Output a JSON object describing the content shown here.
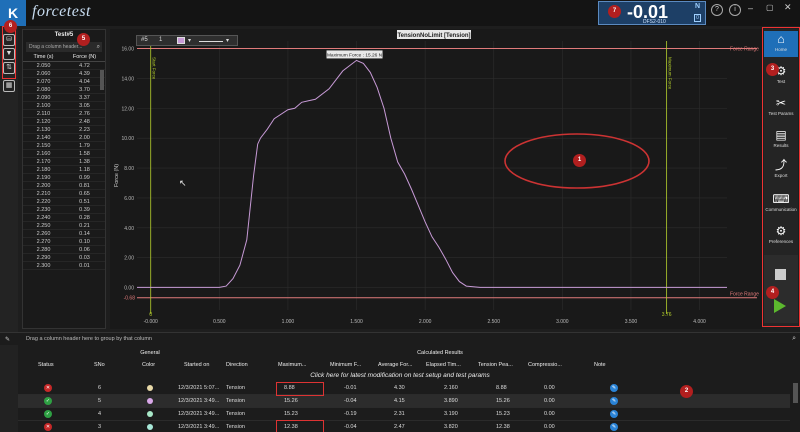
{
  "app": {
    "logo_text": "forcetest",
    "logo_glyph": "K"
  },
  "readout": {
    "value": "-0.01",
    "unit": "N",
    "device": "DFS2-010",
    "mode": "0"
  },
  "left_toolbar": {
    "icons": [
      "database-icon",
      "filter-icon",
      "sort-icon",
      "table-icon"
    ]
  },
  "data_panel": {
    "title": "Test#5",
    "search_placeholder": "Drag a column header...",
    "columns": [
      "Time (s)",
      "Force (N)"
    ],
    "rows": [
      [
        "2.050",
        "4.72"
      ],
      [
        "2.060",
        "4.39"
      ],
      [
        "2.070",
        "4.04"
      ],
      [
        "2.080",
        "3.70"
      ],
      [
        "2.090",
        "3.37"
      ],
      [
        "2.100",
        "3.05"
      ],
      [
        "2.110",
        "2.76"
      ],
      [
        "2.120",
        "2.48"
      ],
      [
        "2.130",
        "2.23"
      ],
      [
        "2.140",
        "2.00"
      ],
      [
        "2.150",
        "1.79"
      ],
      [
        "2.160",
        "1.58"
      ],
      [
        "2.170",
        "1.38"
      ],
      [
        "2.180",
        "1.18"
      ],
      [
        "2.190",
        "0.99"
      ],
      [
        "2.200",
        "0.81"
      ],
      [
        "2.210",
        "0.65"
      ],
      [
        "2.220",
        "0.51"
      ],
      [
        "2.230",
        "0.39"
      ],
      [
        "2.240",
        "0.28"
      ],
      [
        "2.250",
        "0.21"
      ],
      [
        "2.260",
        "0.14"
      ],
      [
        "2.270",
        "0.10"
      ],
      [
        "2.280",
        "0.06"
      ],
      [
        "2.290",
        "0.03"
      ],
      [
        "2.300",
        "0.01"
      ]
    ]
  },
  "chart_toolbar": {
    "series": "#5",
    "count": "1"
  },
  "chart_data": {
    "type": "line",
    "title": "TensionNoLimit [Tension]",
    "xlabel": "Time (s)",
    "ylabel": "Force (N)",
    "xlim": [
      -0.1,
      4.2
    ],
    "ylim": [
      -1.5,
      16.5
    ],
    "x_ticks": [
      "-0.000",
      "0.500",
      "1.000",
      "1.500",
      "2.000",
      "2.500",
      "3.000",
      "3.500",
      "4.000"
    ],
    "y_ticks": [
      "16.00",
      "14.00",
      "12.00",
      "10.00",
      "8.00",
      "6.00",
      "4.00",
      "2.00",
      "0.00"
    ],
    "series": [
      {
        "color": "#c79ad6",
        "x": [
          -0.1,
          0.5,
          0.55,
          0.6,
          0.65,
          0.7,
          0.75,
          0.78,
          0.8,
          0.85,
          0.9,
          1.0,
          1.05,
          1.1,
          1.15,
          1.2,
          1.3,
          1.4,
          1.5,
          1.55,
          1.6,
          1.65,
          1.7,
          1.75,
          1.8,
          1.85,
          1.9,
          1.95,
          2.0,
          2.05,
          2.1,
          2.15,
          2.2,
          2.25,
          2.3,
          2.4,
          4.2
        ],
        "y": [
          0.01,
          0.01,
          0.1,
          0.6,
          1.5,
          3.2,
          7.5,
          9.6,
          10.0,
          10.6,
          11.3,
          11.9,
          12.0,
          12.4,
          12.5,
          12.6,
          13.3,
          14.5,
          15.2,
          15.0,
          14.4,
          13.4,
          12.0,
          10.0,
          8.4,
          7.6,
          6.6,
          5.5,
          4.4,
          3.4,
          2.7,
          1.9,
          1.0,
          0.4,
          0.1,
          0.01,
          0.01
        ]
      }
    ],
    "annotations": {
      "max_force_label": "Maximum Force : 15.26 N",
      "force_range_label": "Force Range",
      "lower_value": "-0.68",
      "left_marker_label": "Start Force",
      "right_marker_label": "Maximum Force",
      "left_marker_x": "0",
      "right_marker_x": "3.76"
    },
    "upper_force_range": 16.0,
    "lower_force_range": -0.68,
    "start_marker": 0.0,
    "end_marker": 3.76,
    "grid": true
  },
  "right_sidebar": {
    "items": [
      {
        "label": "Home",
        "icon": "home-icon",
        "glyph": "⌂"
      },
      {
        "label": "Test",
        "icon": "test-icon",
        "glyph": "⚙"
      },
      {
        "label": "Test Params",
        "icon": "tools-icon",
        "glyph": "✂"
      },
      {
        "label": "Results",
        "icon": "results-icon",
        "glyph": "▤"
      },
      {
        "label": "Export",
        "icon": "export-icon",
        "glyph": "⤴"
      },
      {
        "label": "Communication",
        "icon": "communication-icon",
        "glyph": "⌨"
      },
      {
        "label": "Preferences",
        "icon": "preferences-icon",
        "glyph": "⚙"
      }
    ]
  },
  "badges": [
    "1",
    "2",
    "3",
    "4",
    "5",
    "6",
    "7"
  ],
  "results_table": {
    "group_hint": "Drag a column header here to group by that column",
    "group_general": "General",
    "group_calc": "Calculated Results",
    "headers": [
      "Status",
      "SNo",
      "Color",
      "Started on",
      "Direction",
      "Maximum...",
      "Minimum F...",
      "Average For...",
      "Elapsed Tim...",
      "Tension Pea...",
      "Compressio...",
      "Note"
    ],
    "click_hint": "Click here for latest modification on test setup and test params",
    "rows": [
      {
        "status": "fail",
        "sno": "6",
        "color": "#e8d9a8",
        "started": "12/3/2021 5:07...",
        "direction": "Tension",
        "max": "8.88",
        "min": "-0.01",
        "avg": "4.30",
        "elapsed": "2.160",
        "tension": "8.88",
        "comp": "0.00"
      },
      {
        "status": "pass",
        "sno": "5",
        "color": "#d9a8e8",
        "started": "12/3/2021 3:49...",
        "direction": "Tension",
        "max": "15.26",
        "min": "-0.04",
        "avg": "4.15",
        "elapsed": "3.890",
        "tension": "15.26",
        "comp": "0.00"
      },
      {
        "status": "pass",
        "sno": "4",
        "color": "#a8e8c8",
        "started": "12/3/2021 3:49...",
        "direction": "Tension",
        "max": "15.23",
        "min": "-0.19",
        "avg": "2.31",
        "elapsed": "3.190",
        "tension": "15.23",
        "comp": "0.00"
      },
      {
        "status": "fail",
        "sno": "3",
        "color": "#a8e8d8",
        "started": "12/3/2021 3:49...",
        "direction": "Tension",
        "max": "12.38",
        "min": "-0.04",
        "avg": "2.47",
        "elapsed": "3.820",
        "tension": "12.38",
        "comp": "0.00"
      }
    ]
  }
}
